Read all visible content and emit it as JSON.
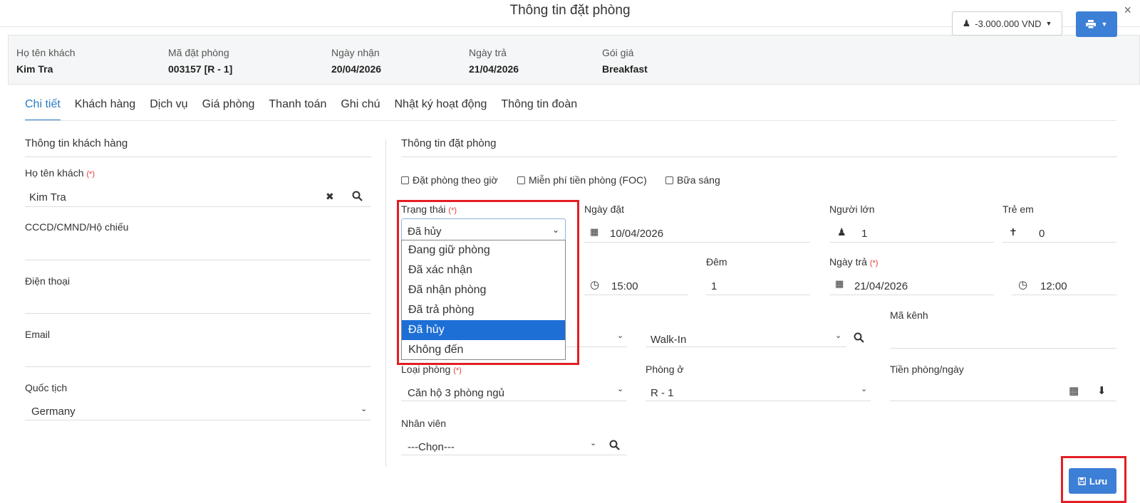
{
  "modal": {
    "title": "Thông tin đặt phòng",
    "close": "×"
  },
  "summary": {
    "guest_label": "Họ tên khách",
    "guest_value": "Kim Tra",
    "code_label": "Mã đặt phòng",
    "code_value": "003157 [R - 1]",
    "checkin_label": "Ngày nhận",
    "checkin_value": "20/04/2026",
    "checkout_label": "Ngày trả",
    "checkout_value": "21/04/2026",
    "rate_label": "Gói giá",
    "rate_value": "Breakfast",
    "balance": "-3.000.000 VND"
  },
  "tabs": [
    "Chi tiết",
    "Khách hàng",
    "Dịch vụ",
    "Giá phòng",
    "Thanh toán",
    "Ghi chú",
    "Nhật ký hoạt động",
    "Thông tin đoàn"
  ],
  "customer": {
    "section_title": "Thông tin khách hàng",
    "name_label": "Họ tên khách",
    "name_value": "Kim Tra",
    "id_label": "CCCD/CMND/Hộ chiếu",
    "phone_label": "Điện thoại",
    "email_label": "Email",
    "nationality_label": "Quốc tịch",
    "nationality_value": "Germany"
  },
  "booking": {
    "section_title": "Thông tin đặt phòng",
    "chk_hourly": "Đặt phòng theo giờ",
    "chk_foc": "Miễn phí tiền phòng (FOC)",
    "chk_breakfast": "Bữa sáng",
    "status_label": "Trạng thái",
    "status_value": "Đã hủy",
    "status_options": [
      "Đang giữ phòng",
      "Đã xác nhận",
      "Đã nhận phòng",
      "Đã trả phòng",
      "Đã hủy",
      "Không đến"
    ],
    "booked_date_label": "Ngày đặt",
    "booked_date_value": "10/04/2026",
    "adults_label": "Người lớn",
    "adults_value": "1",
    "children_label": "Trẻ em",
    "children_value": "0",
    "checkin_time_value": "15:00",
    "nights_label": "Đêm",
    "nights_value": "1",
    "checkout_label": "Ngày trả",
    "checkout_value": "21/04/2026",
    "checkout_time_value": "12:00",
    "source_value": "Walk-In",
    "channel_code_label": "Mã kênh",
    "room_type_label": "Loại phòng",
    "room_type_value": "Căn hộ 3 phòng ngủ",
    "room_label": "Phòng ở",
    "room_value": "R - 1",
    "rate_label": "Tiền phòng/ngày",
    "staff_label": "Nhân viên",
    "staff_value": "---Chọn---",
    "required_mark": "(*)"
  },
  "save_label": "Lưu",
  "colors": {
    "primary": "#3c7fd6",
    "highlight_box": "#e31e24",
    "active_tab": "#2c7bc4",
    "selected_option": "#1d6fd6"
  }
}
